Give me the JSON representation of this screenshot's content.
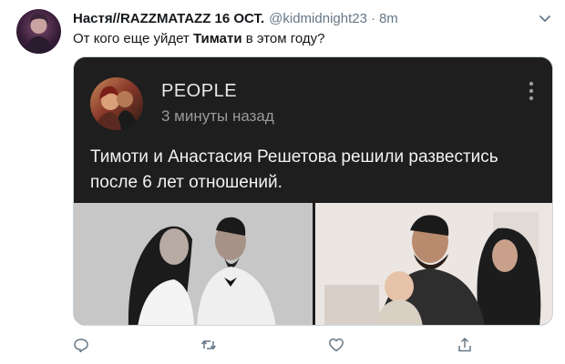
{
  "tweet": {
    "display_name": "Настя//RAZZMATAZZ 16 ОСТ.",
    "handle": "@kidmidnight23",
    "separator": "·",
    "time": "8m",
    "text_before": "От кого еще уйдет ",
    "text_bold": "Тимати",
    "text_after": " в этом году?"
  },
  "card": {
    "source_name": "PEOPLE",
    "source_time": "3 минуты назад",
    "headline": "Тимоти и Анастасия Решетова решили развестись после 6 лет отношений."
  },
  "colors": {
    "text_primary": "#14171a",
    "text_secondary": "#657786",
    "card_dark": "#1e1e1e",
    "icon_gray": "#657786"
  },
  "icons": [
    "reply-icon",
    "retweet-icon",
    "like-icon",
    "share-icon",
    "caret-down-icon",
    "kebab-menu-icon"
  ]
}
